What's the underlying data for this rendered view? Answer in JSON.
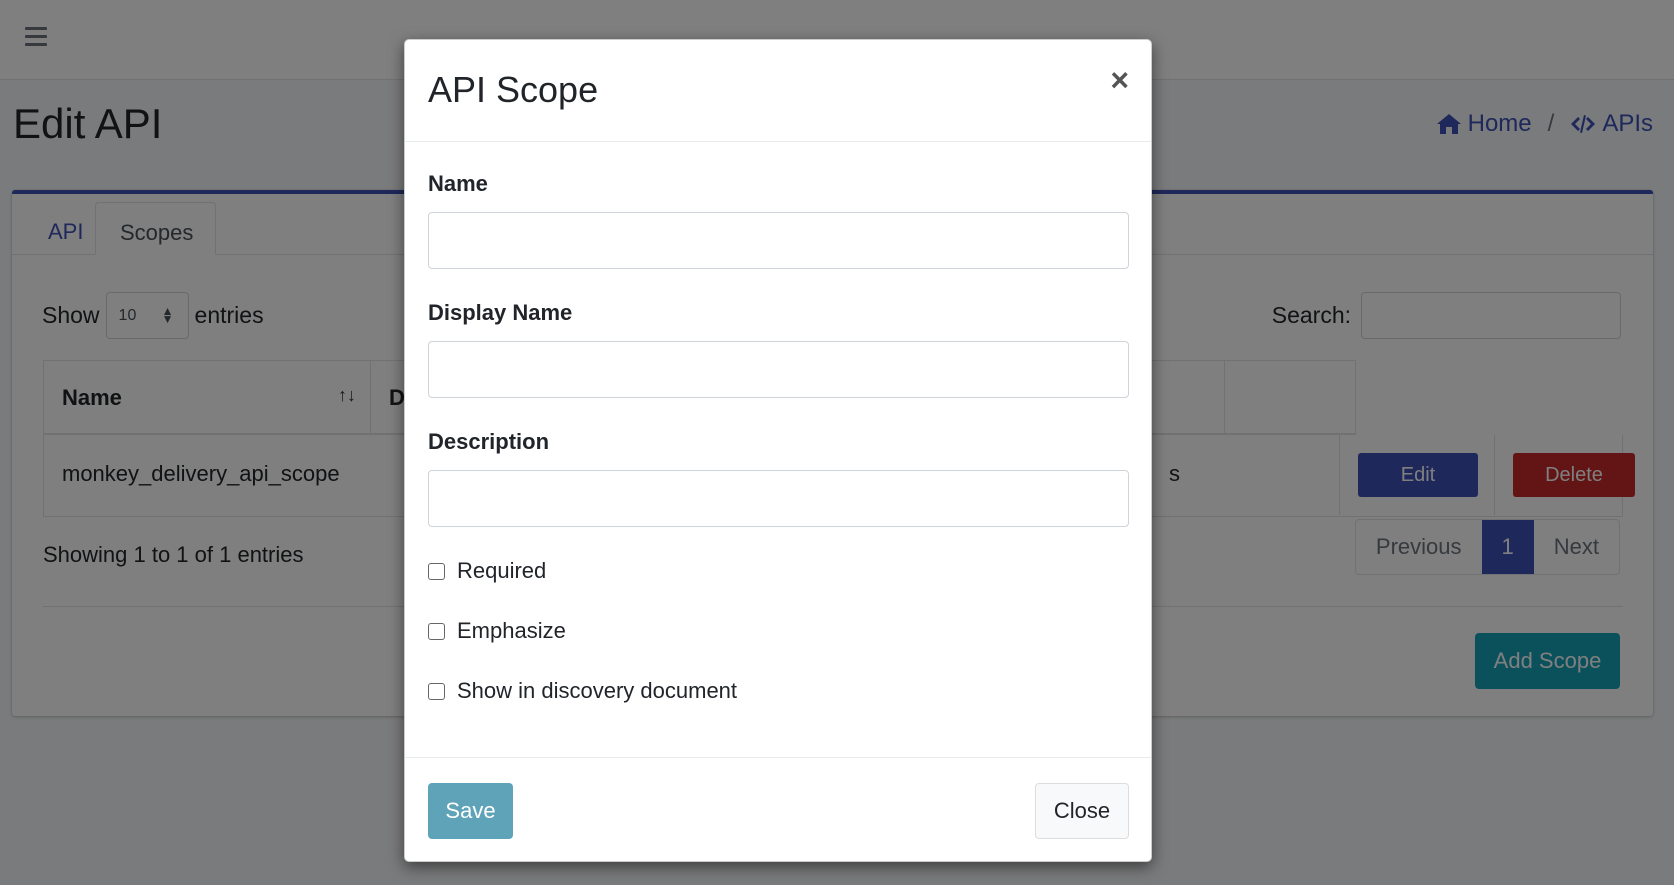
{
  "page": {
    "title": "Edit API",
    "breadcrumb": [
      {
        "label": "Home",
        "icon": "home-icon"
      },
      {
        "label": "APIs",
        "icon": "code-icon"
      }
    ],
    "breadcrumb_separator": "/"
  },
  "tabs": [
    {
      "label": "API",
      "active": false
    },
    {
      "label": "Scopes",
      "active": true
    }
  ],
  "table_controls": {
    "show_label": "Show",
    "entries_value": "10",
    "entries_label": "entries",
    "search_label": "Search:"
  },
  "table": {
    "columns": [
      "Name",
      "D"
    ],
    "rows": [
      {
        "name": "monkey_delivery_api_scope",
        "partial_text": "s",
        "edit_label": "Edit",
        "delete_label": "Delete"
      }
    ],
    "info": "Showing 1 to 1 of 1 entries",
    "pagination": {
      "previous": "Previous",
      "current": "1",
      "next": "Next"
    },
    "add_button": "Add Scope"
  },
  "modal": {
    "title": "API Scope",
    "close_symbol": "×",
    "fields": [
      {
        "label": "Name",
        "value": ""
      },
      {
        "label": "Display Name",
        "value": ""
      },
      {
        "label": "Description",
        "value": ""
      }
    ],
    "checkboxes": [
      {
        "label": "Required",
        "checked": false
      },
      {
        "label": "Emphasize",
        "checked": false
      },
      {
        "label": "Show in discovery document",
        "checked": false
      }
    ],
    "save_label": "Save",
    "close_label": "Close"
  },
  "colors": {
    "primary": "#3f51b5",
    "danger": "#c62828",
    "info": "#17a2b8",
    "save": "#5fa3b8"
  }
}
